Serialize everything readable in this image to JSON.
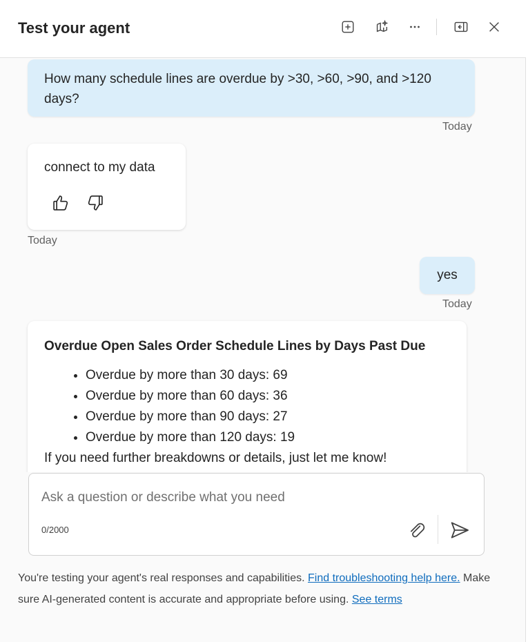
{
  "header": {
    "title": "Test your agent",
    "icons": [
      "new-chat-icon",
      "sparkle-map-icon",
      "more-icon",
      "collapse-panel-icon",
      "close-icon"
    ]
  },
  "messages": {
    "user1": {
      "text": "How many schedule lines are overdue by >30, >60, >90, and >120 days?",
      "timestamp": "Today"
    },
    "bot1": {
      "text": "connect to my data",
      "timestamp": "Today"
    },
    "user2": {
      "text": "yes",
      "timestamp": "Today"
    },
    "bot2": {
      "title": "Overdue Open Sales Order Schedule Lines by Days Past Due",
      "items": [
        "Overdue by more than 30 days: 69",
        "Overdue by more than 60 days: 36",
        "Overdue by more than 90 days: 27",
        "Overdue by more than 120 days: 19"
      ],
      "footer": "If you need further breakdowns or details, just let me know!"
    }
  },
  "input": {
    "placeholder": "Ask a question or describe what you need",
    "counter": "0/2000"
  },
  "footer": {
    "text1": "You're testing your agent's real responses and capabilities. ",
    "link1": "Find troubleshooting help here.",
    "text2": " Make sure AI-generated content is accurate and appropriate before using. ",
    "link2": "See terms"
  },
  "colors": {
    "accent": "#0f6cbd",
    "user_bubble": "#dbeefa"
  }
}
